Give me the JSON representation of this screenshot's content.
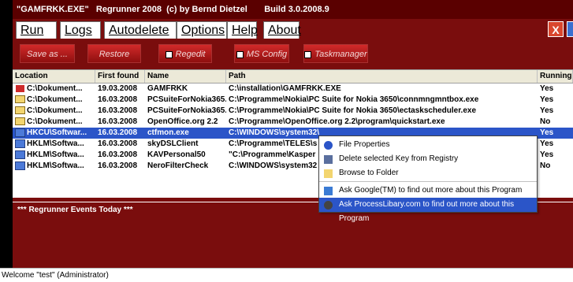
{
  "app": {
    "title": "\"GAMFRKK.EXE\"   Regrunner 2008  (c) by Bernd Dietzel       Build 3.0.2008.9",
    "close_symbol": "X"
  },
  "menu": [
    "Run",
    "Logs",
    "Autodelete",
    "Options",
    "Help",
    "About"
  ],
  "toolbar": [
    "Save as ...",
    "Restore",
    "Regedit",
    "MS Config",
    "Taskmanager"
  ],
  "table": {
    "headers": [
      "Location",
      "First found",
      "Name",
      "Path",
      "Running"
    ],
    "rows": [
      {
        "location": "C:\\Dokument...",
        "first_found": "19.03.2008",
        "name": "GAMFRKK",
        "path": "C:\\installation\\GAMFRKK.EXE",
        "running": "Yes",
        "icon": "run-icon"
      },
      {
        "location": "C:\\Dokument...",
        "first_found": "16.03.2008",
        "name": "PCSuiteForNokia365...",
        "path": "C:\\Programme\\Nokia\\PC Suite for Nokia 3650\\connmngmntbox.exe",
        "running": "Yes",
        "icon": "folder-icon"
      },
      {
        "location": "C:\\Dokument...",
        "first_found": "16.03.2008",
        "name": "PCSuiteForNokia365...",
        "path": "C:\\Programme\\Nokia\\PC Suite for Nokia 3650\\ectaskscheduler.exe",
        "running": "Yes",
        "icon": "folder-icon"
      },
      {
        "location": "C:\\Dokument...",
        "first_found": "16.03.2008",
        "name": "OpenOffice.org 2.2",
        "path": "C:\\Programme\\OpenOffice.org 2.2\\program\\quickstart.exe",
        "running": "No",
        "icon": "folder-icon"
      },
      {
        "location": "HKCU\\Softwar...",
        "first_found": "16.03.2008",
        "name": "ctfmon.exe",
        "path": "C:\\WINDOWS\\system32\\",
        "running": "Yes",
        "icon": "registry-icon",
        "selected": true
      },
      {
        "location": "HKLM\\Softwa...",
        "first_found": "16.03.2008",
        "name": "skyDSLClient",
        "path": "C:\\Programme\\TELES\\s",
        "running": "Yes",
        "icon": "registry-icon"
      },
      {
        "location": "HKLM\\Softwa...",
        "first_found": "16.03.2008",
        "name": "KAVPersonal50",
        "path": "\"C:\\Programme\\Kasper",
        "running": "Yes",
        "icon": "registry-icon"
      },
      {
        "location": "HKLM\\Softwa...",
        "first_found": "16.03.2008",
        "name": "NeroFilterCheck",
        "path": "C:\\WINDOWS\\system32",
        "running": "No",
        "icon": "registry-icon"
      }
    ]
  },
  "events": {
    "label": "*** Regrunner Events Today ***"
  },
  "context_menu": [
    {
      "label": "File Properties",
      "icon": "info-icon"
    },
    {
      "label": "Delete selected Key from Registry",
      "icon": "delete-icon"
    },
    {
      "label": "Browse to Folder",
      "icon": "folder-icon"
    },
    {
      "label": "Ask Google(TM) to find out more about this Program",
      "icon": "google-icon"
    },
    {
      "label": "Ask ProcessLibary.com to find out more about this Program",
      "icon": "processlibrary-icon"
    }
  ],
  "status": {
    "text": "Welcome \"test\" (Administrator)"
  },
  "colors": {
    "window_bg": "#7a0d0d",
    "selected_row": "#2b55c8",
    "button_red": "#c41f1f"
  }
}
